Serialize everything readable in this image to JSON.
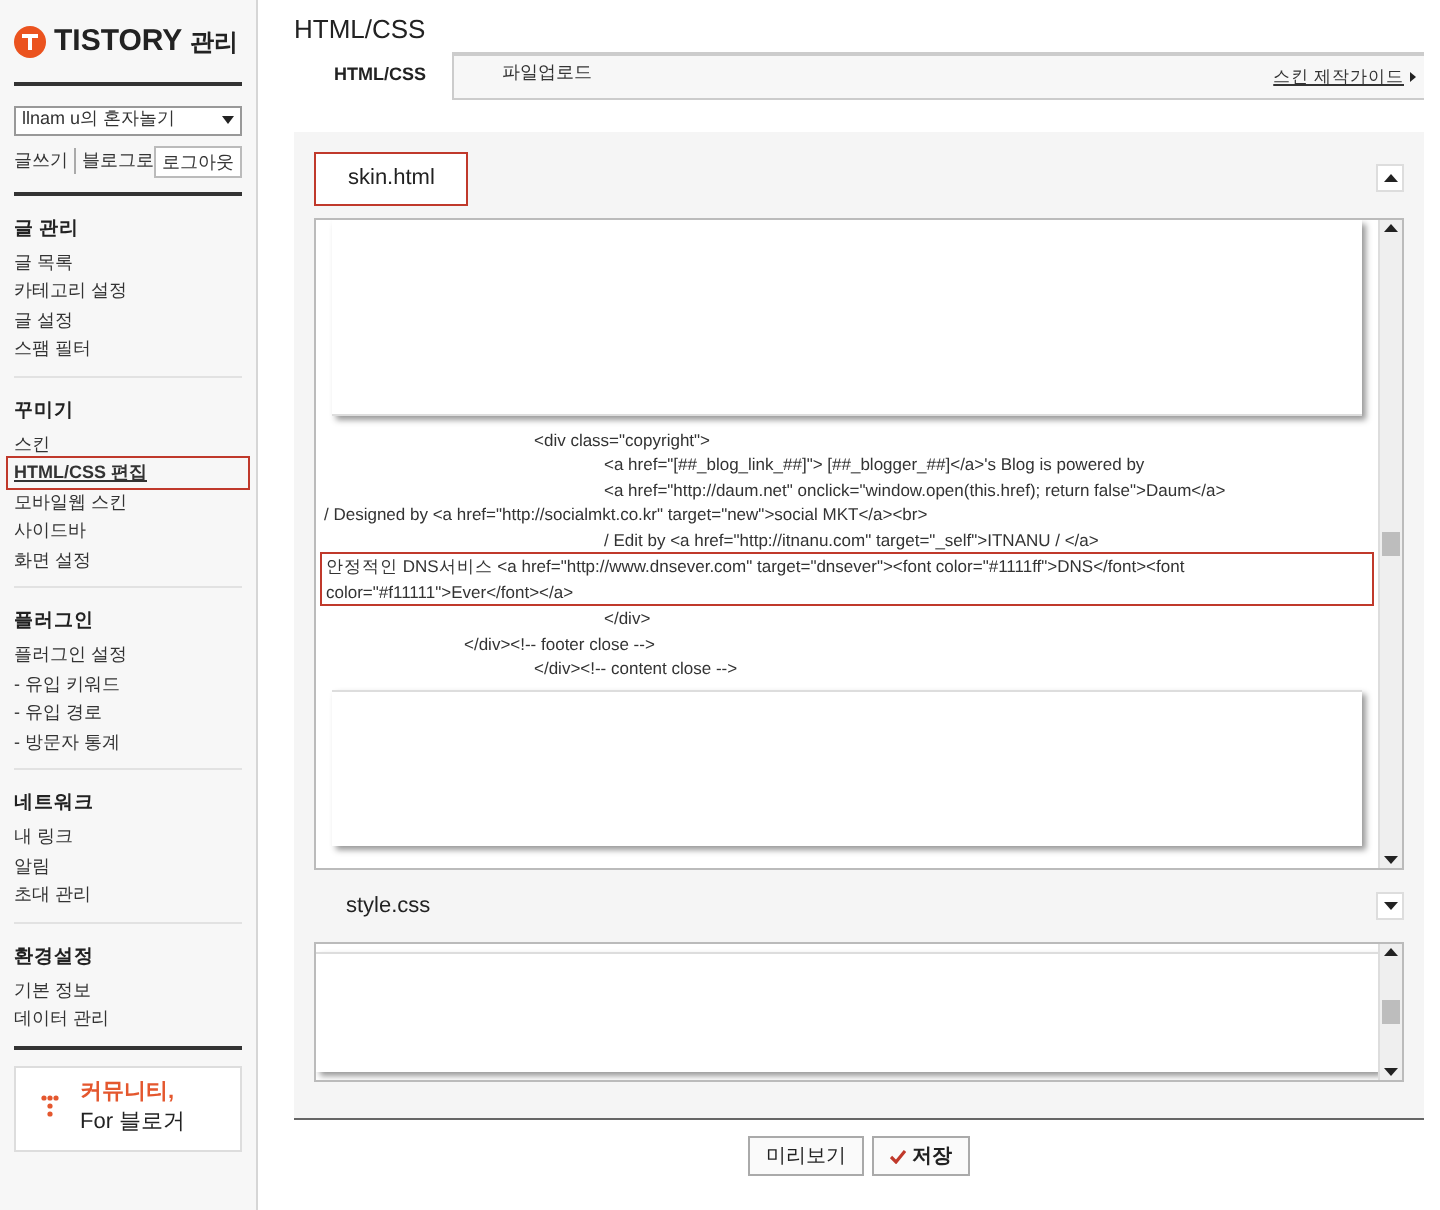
{
  "brand": {
    "name": "TISTORY",
    "suffix": "관리"
  },
  "blog_select": {
    "value": "llnam u의 혼자놀기"
  },
  "quick_links": [
    "글쓰기",
    "블로그로"
  ],
  "logout": "로그아웃",
  "sidebar": [
    {
      "title": "글 관리",
      "items": [
        {
          "label": "글 목록",
          "selected": false
        },
        {
          "label": "카테고리 설정",
          "selected": false
        },
        {
          "label": "글 설정",
          "selected": false
        },
        {
          "label": "스팸 필터",
          "selected": false
        }
      ]
    },
    {
      "title": "꾸미기",
      "items": [
        {
          "label": "스킨",
          "selected": false
        },
        {
          "label": "HTML/CSS 편집",
          "selected": true
        },
        {
          "label": "모바일웹 스킨",
          "selected": false
        },
        {
          "label": "사이드바",
          "selected": false
        },
        {
          "label": "화면 설정",
          "selected": false
        }
      ]
    },
    {
      "title": "플러그인",
      "items": [
        {
          "label": "플러그인 설정",
          "selected": false
        },
        {
          "label": "- 유입 키워드",
          "selected": false
        },
        {
          "label": "- 유입 경로",
          "selected": false
        },
        {
          "label": "- 방문자 통계",
          "selected": false
        }
      ]
    },
    {
      "title": "네트워크",
      "items": [
        {
          "label": "내 링크",
          "selected": false
        },
        {
          "label": "알림",
          "selected": false
        },
        {
          "label": "초대 관리",
          "selected": false
        }
      ]
    },
    {
      "title": "환경설정",
      "items": [
        {
          "label": "기본 정보",
          "selected": false
        },
        {
          "label": "데이터 관리",
          "selected": false
        }
      ]
    }
  ],
  "banner": {
    "line_1": "커뮤니티,",
    "line_2": "For 블로거"
  },
  "page_title": "HTML/CSS",
  "tabs": [
    {
      "label": "HTML/CSS",
      "selected": true
    },
    {
      "label": "파일업로드",
      "selected": false
    }
  ],
  "guide_link": "스킨 제작가이드",
  "editors": [
    {
      "file": "skin.html",
      "highlighted": true,
      "expanded": true,
      "lines": [
        {
          "text": "\t\t\t<div class=\"copyright\">",
          "highlighted": false
        },
        {
          "text": "\t\t\t\t<a href=\"[##_blog_link_##]\"> [##_blogger_##]</a>'s Blog is powered by",
          "highlighted": false
        },
        {
          "text": "\t\t\t\t<a href=\"http://daum.net\" onclick=\"window.open(this.href); return false\">Daum</a>",
          "highlighted": false
        },
        {
          "text": "/ Designed by <a href=\"http://socialmkt.co.kr\" target=\"new\">social MKT</a><br>",
          "highlighted": false
        },
        {
          "text": "\t\t\t\t/ Edit by <a href=\"http://itnanu.com\" target=\"_self\">ITNANU / </a>",
          "highlighted": false
        },
        {
          "text": "안정적인 DNS서비스 <a href=\"http://www.dnsever.com\" target=\"dnsever\"><font color=\"#1111ff\">DNS</font><font color=\"#f11111\">Ever</font></a>",
          "highlighted": true
        },
        {
          "text": "\t\t\t\t</div>",
          "highlighted": false
        },
        {
          "text": "\t\t</div><!-- footer close -->",
          "highlighted": false
        },
        {
          "text": "\t\t\t</div><!-- content close -->",
          "highlighted": false
        }
      ]
    },
    {
      "file": "style.css",
      "highlighted": false,
      "expanded": false
    }
  ],
  "buttons": [
    {
      "label": "미리보기",
      "kind": "plain"
    },
    {
      "label": "저장",
      "kind": "save"
    }
  ]
}
